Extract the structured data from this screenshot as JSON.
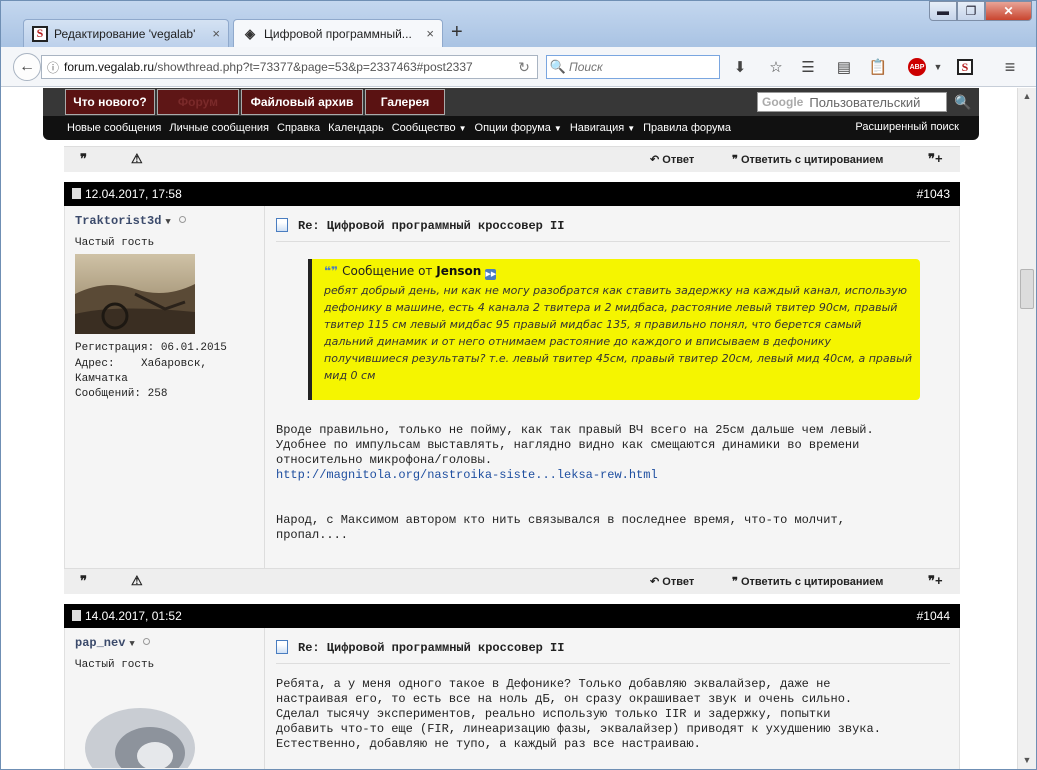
{
  "browser": {
    "tabs": [
      {
        "label": "Редактирование 'vegalab'",
        "close": "×"
      },
      {
        "label": "Цифровой программный...",
        "close": "×"
      }
    ],
    "new_tab": "+",
    "window": {
      "min": "▬",
      "max": "❐",
      "close": "✕"
    },
    "url_host": "forum.vegalab.ru",
    "url_path": "/showthread.php?t=73377&page=53&p=2337463#post2337",
    "search_placeholder": "Поиск"
  },
  "forum": {
    "top_buttons": [
      "Что нового?",
      "Форум",
      "Файловый архив",
      "Галерея"
    ],
    "google_logo": "Google",
    "google_placeholder": "Пользовательский",
    "nav": [
      {
        "label": "Новые сообщения",
        "caret": ""
      },
      {
        "label": "Личные сообщения",
        "caret": ""
      },
      {
        "label": "Справка",
        "caret": ""
      },
      {
        "label": "Календарь",
        "caret": ""
      },
      {
        "label": "Сообщество",
        "caret": "▼"
      },
      {
        "label": "Опции форума",
        "caret": "▼"
      },
      {
        "label": "Навигация",
        "caret": "▼"
      },
      {
        "label": "Правила форума",
        "caret": ""
      }
    ],
    "advanced_search": "Расширенный поиск"
  },
  "toolbar": {
    "reply": "Ответ",
    "reply_quote": "Ответить с цитированием"
  },
  "posts": [
    {
      "date": "12.04.2017, 17:58",
      "number": "#1043",
      "username": "Traktorist3d",
      "user_title": "Частый гость",
      "registration": "Регистрация:  06.01.2015",
      "address": "Адрес:    Хабаровск,\nКамчатка",
      "messages": "Сообщений:  258",
      "title": "Re: Цифровой программный кроссовер II",
      "quote_label": "Сообщение от",
      "quote_author": "Jenson",
      "quote_text": "ребят добрый день, ни как не могу разобратся как ставить задержку на каждый канал, использую дефонику в машине, есть 4 канала 2 твитера и 2 мидбаса, растояние левый твитер 90см, правый твитер 115 см левый мидбас 95 правый мидбас 135, я правильно понял, что берется самый дальний динамик и от него отнимаем растояние до каждого и вписываем в дефонику получившиеся результаты? т.е. левый твитер 45см, правый твитер 20см, левый мид 40см, а правый мид 0 см",
      "text1": "Вроде правильно, только не пойму, как так правый ВЧ всего на 25см дальше чем левый.\nУдобнее по импульсам выставлять, наглядно видно как смещаются динамики во времени\nотносительно микрофона/головы.",
      "link": "http://magnitola.org/nastroika-siste...leksa-rew.html",
      "text2": "Народ, с Максимом автором кто нить связывался в последнее время, что-то молчит,\nпропал...."
    },
    {
      "date": "14.04.2017, 01:52",
      "number": "#1044",
      "username": "pap_nev",
      "user_title": "Частый гость",
      "title": "Re: Цифровой программный кроссовер II",
      "text1": "Ребята, а у меня одного такое в Дефонике? Только добавляю эквалайзер, даже не\nнастраивая его, то есть все на ноль дБ, он сразу окрашивает звук и очень сильно.\nСделал тысячу экспериментов, реально использую только IIR и задержку, попытки\nдобавить что-то еще (FIR, линеаризацию фазы, эквалайзер) приводят к ухудшению звука.\nЕстественно, добавляю не тупо, а каждый раз все настраиваю."
    }
  ]
}
